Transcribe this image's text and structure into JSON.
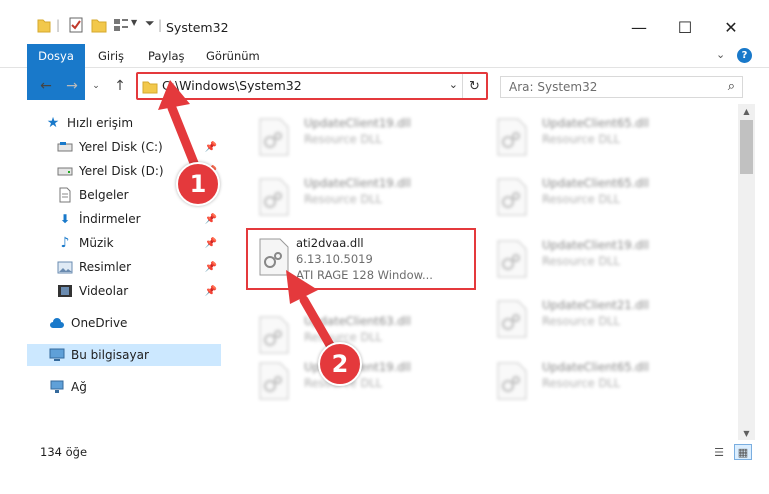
{
  "window": {
    "title": "System32"
  },
  "ribbon": {
    "tabs": [
      "Dosya",
      "Giriş",
      "Paylaş",
      "Görünüm"
    ]
  },
  "address": {
    "path": "C:\\Windows\\System32"
  },
  "search": {
    "placeholder": "Ara: System32"
  },
  "sidebar": {
    "quick_access": "Hızlı erişim",
    "items": [
      {
        "label": "Yerel Disk (C:)",
        "icon": "drive-icon",
        "pinned": true
      },
      {
        "label": "Yerel Disk (D:)",
        "icon": "drive-icon",
        "pinned": true
      },
      {
        "label": "Belgeler",
        "icon": "documents-icon",
        "pinned": true
      },
      {
        "label": "İndirmeler",
        "icon": "download-icon",
        "pinned": true
      },
      {
        "label": "Müzik",
        "icon": "music-icon",
        "pinned": true
      },
      {
        "label": "Resimler",
        "icon": "pictures-icon",
        "pinned": true
      },
      {
        "label": "Videolar",
        "icon": "video-icon",
        "pinned": true
      }
    ],
    "onedrive": "OneDrive",
    "this_pc": "Bu bilgisayar",
    "network": "Ağ"
  },
  "files": {
    "col1": [
      {
        "name": "UpdateClient19.dll",
        "type": "Resource DLL"
      },
      {
        "name": "UpdateClient19.dll",
        "type": "Resource DLL"
      },
      {
        "name": "ati2dvaa.dll",
        "version": "6.13.10.5019",
        "description": "ATI RAGE 128 Window..."
      },
      {
        "name": "UpdateClient63.dll",
        "type": "Resource DLL"
      },
      {
        "name": "UpdateClient19.dll",
        "type": "Resource DLL"
      }
    ],
    "col2": [
      {
        "name": "UpdateClient65.dll",
        "type": "Resource DLL"
      },
      {
        "name": "UpdateClient65.dll",
        "type": "Resource DLL"
      },
      {
        "name": "UpdateClient19.dll",
        "type": "Resource DLL"
      },
      {
        "name": "UpdateClient21.dll",
        "type": "Resource DLL"
      },
      {
        "name": "UpdateClient65.dll",
        "type": "Resource DLL"
      }
    ]
  },
  "status": {
    "item_count": "134 öğe"
  },
  "annotations": {
    "step1": "1",
    "step2": "2"
  },
  "colors": {
    "accent": "#1979ca",
    "highlight": "#e4393c",
    "selected": "#cce8ff"
  }
}
